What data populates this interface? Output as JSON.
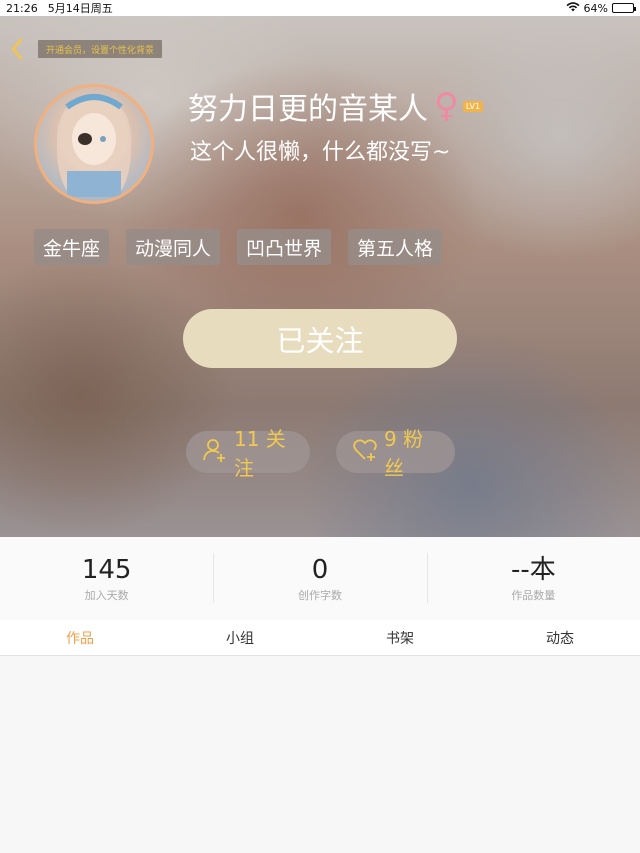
{
  "status_bar": {
    "time": "21:26",
    "date": "5月14日周五",
    "battery": "64%",
    "battery_level": 0.64
  },
  "header": {
    "vip_banner": "开通会员，设置个性化背景",
    "username": "努力日更的音某人",
    "gender_icon": "female-symbol-icon",
    "level": "LV1",
    "bio": "这个人很懒，什么都没写~",
    "tags": [
      "金牛座",
      "动漫同人",
      "凹凸世界",
      "第五人格"
    ],
    "follow_button": "已关注",
    "following": "11 关注",
    "fans": "9 粉丝"
  },
  "stats": [
    {
      "value": "145",
      "label": "加入天数"
    },
    {
      "value": "0",
      "label": "创作字数"
    },
    {
      "value": "--本",
      "label": "作品数量"
    }
  ],
  "tabs": [
    {
      "label": "作品",
      "active": true
    },
    {
      "label": "小组",
      "active": false
    },
    {
      "label": "书架",
      "active": false
    },
    {
      "label": "动态",
      "active": false
    }
  ],
  "colors": {
    "accent": "#f0a04a",
    "gold_text": "#f0c94e",
    "follow_button_bg": "#e8dcbf",
    "gender": "#f08aa4"
  }
}
